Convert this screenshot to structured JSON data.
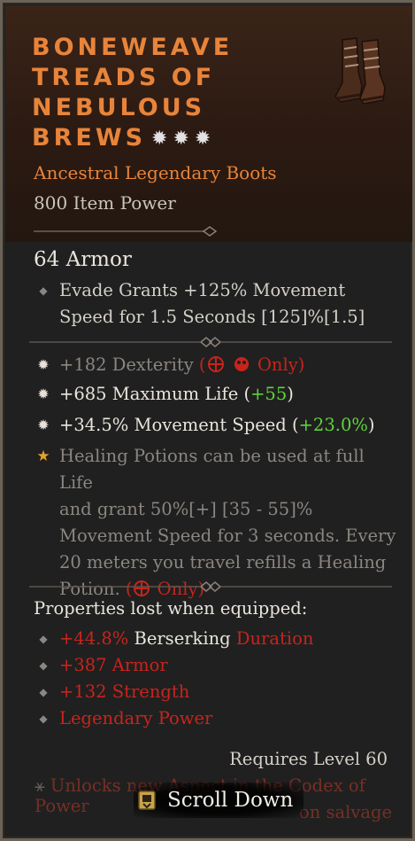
{
  "item": {
    "name_lines": [
      "Boneweave",
      "Treads of",
      "Nebulous",
      "Brews"
    ],
    "star_icons": [
      "greater-affix-star-icon",
      "greater-affix-star-icon",
      "greater-affix-star-icon"
    ],
    "icon": "boots-icon",
    "type": "Ancestral Legendary Boots",
    "power": "800 Item Power",
    "armor": "64 Armor"
  },
  "implicit": {
    "line1": "Evade Grants +125% Movement",
    "line2": "Speed for 1.5 Seconds [125]%[1.5]"
  },
  "affixes": [
    {
      "icon": "spark-icon",
      "text": "+182 Dexterity",
      "restriction_open": "(",
      "class_icons": [
        "rogue-class-icon",
        "druid-class-icon"
      ],
      "only": "Only)"
    },
    {
      "icon": "spark-icon",
      "text": "+685 Maximum Life (",
      "delta": "+55",
      "close": ")"
    },
    {
      "icon": "spark-icon",
      "text": "+34.5% Movement Speed (",
      "delta": "+23.0%",
      "close": ")"
    }
  ],
  "aspect": {
    "icon": "legendary-star-icon",
    "lines": [
      "Healing Potions can be used at full Life",
      "and grant 50%[+] [35 - 55]%",
      "Movement Speed for 3 seconds. Every",
      "20 meters you travel refills a Healing",
      "Potion."
    ],
    "restriction_open": "(",
    "class_icon": "rogue-class-icon",
    "only": "Only)"
  },
  "lost": {
    "header": "Properties lost when equipped:",
    "items": [
      {
        "red_a": "+44.8%",
        "white": " Berserking ",
        "red_b": "Duration"
      },
      {
        "red_a": "+387 Armor",
        "white": "",
        "red_b": ""
      },
      {
        "red_a": "+132 Strength",
        "white": "",
        "red_b": ""
      },
      {
        "red_a": "Legendary Power",
        "white": "",
        "red_b": ""
      }
    ]
  },
  "requires": "Requires Level 60",
  "unlock": {
    "text_a": "Unlocks ne",
    "text_b": "w Aspect in the Codex of Power",
    "text_c": "on salvage"
  },
  "scroll": {
    "label": "Scroll Down",
    "icon": "scroll-key-icon"
  },
  "colors": {
    "title": "#e8843a",
    "red": "#c8241c",
    "green": "#5ed33c",
    "gold": "#e6a12c"
  }
}
